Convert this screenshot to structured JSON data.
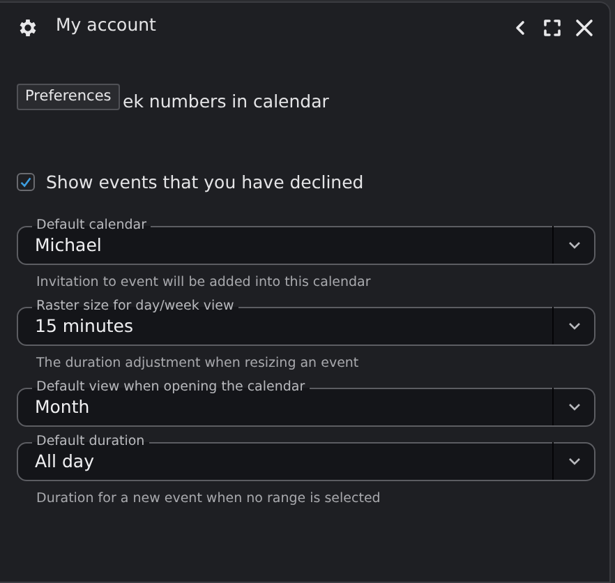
{
  "window": {
    "title": "My account"
  },
  "tooltip": {
    "text": "Preferences"
  },
  "options": [
    {
      "label": "ek numbers in calendar",
      "covered": true
    },
    {
      "label": "Show events that you have declined",
      "covered": false,
      "checked": true
    }
  ],
  "fields": [
    {
      "label": "Default calendar",
      "value": "Michael",
      "helper": "Invitation to event will be added into this calendar"
    },
    {
      "label": "Raster size for day/week view",
      "value": "15 minutes",
      "helper": "The duration adjustment when resizing an event"
    },
    {
      "label": "Default view when opening the calendar",
      "value": "Month"
    },
    {
      "label": "Default duration",
      "value": "All day",
      "helper": "Duration for a new event when no range is selected"
    }
  ]
}
